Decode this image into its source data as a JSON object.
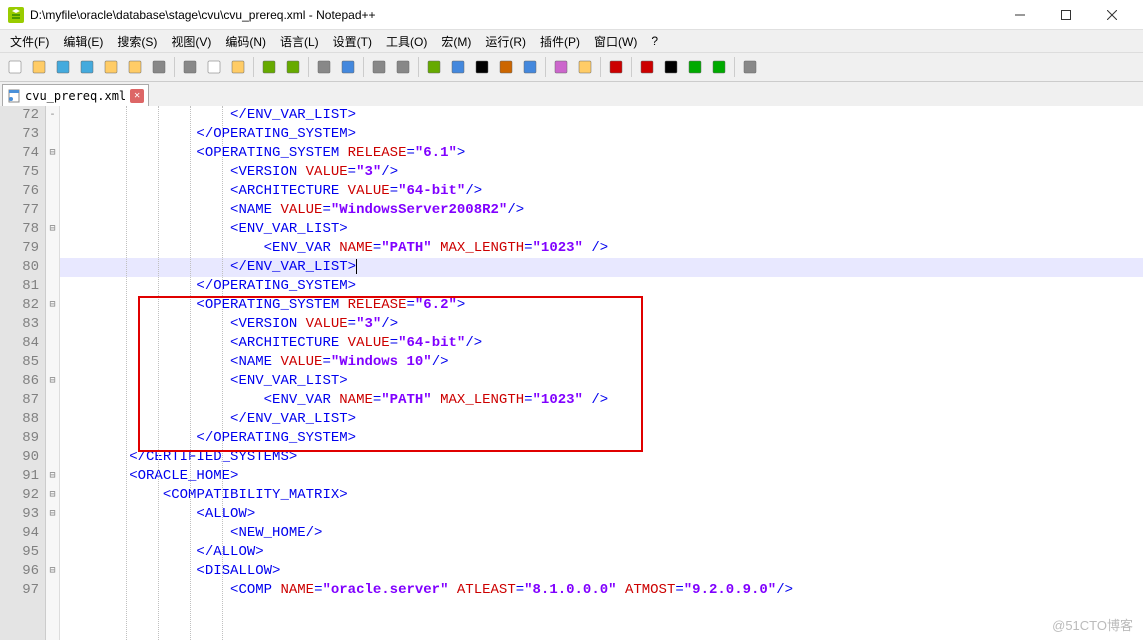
{
  "window": {
    "title": "D:\\myfile\\oracle\\database\\stage\\cvu\\cvu_prereq.xml - Notepad++"
  },
  "menu": {
    "items": [
      "文件(F)",
      "编辑(E)",
      "搜索(S)",
      "视图(V)",
      "编码(N)",
      "语言(L)",
      "设置(T)",
      "工具(O)",
      "宏(M)",
      "运行(R)",
      "插件(P)",
      "窗口(W)",
      "?"
    ]
  },
  "tab": {
    "name": "cvu_prereq.xml"
  },
  "gutter": {
    "start": 72,
    "end": 97
  },
  "code": {
    "lines": [
      {
        "n": 72,
        "ind": 20,
        "parts": [
          {
            "c": "t-blue",
            "t": "</"
          },
          {
            "c": "t-blue",
            "t": "ENV_VAR_LIST"
          },
          {
            "c": "t-blue",
            "t": ">"
          }
        ]
      },
      {
        "n": 73,
        "ind": 16,
        "parts": [
          {
            "c": "t-blue",
            "t": "</"
          },
          {
            "c": "t-blue",
            "t": "OPERATING_SYSTEM"
          },
          {
            "c": "t-blue",
            "t": ">"
          }
        ]
      },
      {
        "n": 74,
        "ind": 16,
        "parts": [
          {
            "c": "t-blue",
            "t": "<"
          },
          {
            "c": "t-blue",
            "t": "OPERATING_SYSTEM"
          },
          {
            "c": "",
            "t": " "
          },
          {
            "c": "t-red",
            "t": "RELEASE"
          },
          {
            "c": "t-blue",
            "t": "="
          },
          {
            "c": "t-purple bold",
            "t": "\"6.1\""
          },
          {
            "c": "t-blue",
            "t": ">"
          }
        ]
      },
      {
        "n": 75,
        "ind": 20,
        "parts": [
          {
            "c": "t-blue",
            "t": "<"
          },
          {
            "c": "t-blue",
            "t": "VERSION"
          },
          {
            "c": "",
            "t": " "
          },
          {
            "c": "t-red",
            "t": "VALUE"
          },
          {
            "c": "t-blue",
            "t": "="
          },
          {
            "c": "t-purple bold",
            "t": "\"3\""
          },
          {
            "c": "t-blue",
            "t": "/>"
          }
        ]
      },
      {
        "n": 76,
        "ind": 20,
        "parts": [
          {
            "c": "t-blue",
            "t": "<"
          },
          {
            "c": "t-blue",
            "t": "ARCHITECTURE"
          },
          {
            "c": "",
            "t": " "
          },
          {
            "c": "t-red",
            "t": "VALUE"
          },
          {
            "c": "t-blue",
            "t": "="
          },
          {
            "c": "t-purple bold",
            "t": "\"64-bit\""
          },
          {
            "c": "t-blue",
            "t": "/>"
          }
        ]
      },
      {
        "n": 77,
        "ind": 20,
        "parts": [
          {
            "c": "t-blue",
            "t": "<"
          },
          {
            "c": "t-blue",
            "t": "NAME"
          },
          {
            "c": "",
            "t": " "
          },
          {
            "c": "t-red",
            "t": "VALUE"
          },
          {
            "c": "t-blue",
            "t": "="
          },
          {
            "c": "t-purple bold",
            "t": "\"WindowsServer2008R2\""
          },
          {
            "c": "t-blue",
            "t": "/>"
          }
        ]
      },
      {
        "n": 78,
        "ind": 20,
        "parts": [
          {
            "c": "t-blue",
            "t": "<"
          },
          {
            "c": "t-blue",
            "t": "ENV_VAR_LIST"
          },
          {
            "c": "t-blue",
            "t": ">"
          }
        ]
      },
      {
        "n": 79,
        "ind": 24,
        "parts": [
          {
            "c": "t-blue",
            "t": "<"
          },
          {
            "c": "t-blue",
            "t": "ENV_VAR"
          },
          {
            "c": "",
            "t": " "
          },
          {
            "c": "t-red",
            "t": "NAME"
          },
          {
            "c": "t-blue",
            "t": "="
          },
          {
            "c": "t-purple bold",
            "t": "\"PATH\""
          },
          {
            "c": "",
            "t": " "
          },
          {
            "c": "t-red",
            "t": "MAX_LENGTH"
          },
          {
            "c": "t-blue",
            "t": "="
          },
          {
            "c": "t-purple bold",
            "t": "\"1023\""
          },
          {
            "c": "",
            "t": " "
          },
          {
            "c": "t-blue",
            "t": "/>"
          }
        ]
      },
      {
        "n": 80,
        "ind": 20,
        "hl": true,
        "cursor": true,
        "parts": [
          {
            "c": "t-blue",
            "t": "</"
          },
          {
            "c": "t-blue",
            "t": "ENV_VAR_LIST"
          },
          {
            "c": "t-blue",
            "t": ">"
          }
        ]
      },
      {
        "n": 81,
        "ind": 16,
        "parts": [
          {
            "c": "t-blue",
            "t": "</"
          },
          {
            "c": "t-blue",
            "t": "OPERATING_SYSTEM"
          },
          {
            "c": "t-blue",
            "t": ">"
          }
        ]
      },
      {
        "n": 82,
        "ind": 16,
        "parts": [
          {
            "c": "t-blue",
            "t": "<"
          },
          {
            "c": "t-blue",
            "t": "OPERATING_SYSTEM"
          },
          {
            "c": "",
            "t": " "
          },
          {
            "c": "t-red",
            "t": "RELEASE"
          },
          {
            "c": "t-blue",
            "t": "="
          },
          {
            "c": "t-purple bold",
            "t": "\"6.2\""
          },
          {
            "c": "t-blue",
            "t": ">"
          }
        ]
      },
      {
        "n": 83,
        "ind": 20,
        "parts": [
          {
            "c": "t-blue",
            "t": "<"
          },
          {
            "c": "t-blue",
            "t": "VERSION"
          },
          {
            "c": "",
            "t": " "
          },
          {
            "c": "t-red",
            "t": "VALUE"
          },
          {
            "c": "t-blue",
            "t": "="
          },
          {
            "c": "t-purple bold",
            "t": "\"3\""
          },
          {
            "c": "t-blue",
            "t": "/>"
          }
        ]
      },
      {
        "n": 84,
        "ind": 20,
        "parts": [
          {
            "c": "t-blue",
            "t": "<"
          },
          {
            "c": "t-blue",
            "t": "ARCHITECTURE"
          },
          {
            "c": "",
            "t": " "
          },
          {
            "c": "t-red",
            "t": "VALUE"
          },
          {
            "c": "t-blue",
            "t": "="
          },
          {
            "c": "t-purple bold",
            "t": "\"64-bit\""
          },
          {
            "c": "t-blue",
            "t": "/>"
          }
        ]
      },
      {
        "n": 85,
        "ind": 20,
        "parts": [
          {
            "c": "t-blue",
            "t": "<"
          },
          {
            "c": "t-blue",
            "t": "NAME"
          },
          {
            "c": "",
            "t": " "
          },
          {
            "c": "t-red",
            "t": "VALUE"
          },
          {
            "c": "t-blue",
            "t": "="
          },
          {
            "c": "t-purple bold",
            "t": "\"Windows 10\""
          },
          {
            "c": "t-blue",
            "t": "/>"
          }
        ]
      },
      {
        "n": 86,
        "ind": 20,
        "parts": [
          {
            "c": "t-blue",
            "t": "<"
          },
          {
            "c": "t-blue",
            "t": "ENV_VAR_LIST"
          },
          {
            "c": "t-blue",
            "t": ">"
          }
        ]
      },
      {
        "n": 87,
        "ind": 24,
        "parts": [
          {
            "c": "t-blue",
            "t": "<"
          },
          {
            "c": "t-blue",
            "t": "ENV_VAR"
          },
          {
            "c": "",
            "t": " "
          },
          {
            "c": "t-red",
            "t": "NAME"
          },
          {
            "c": "t-blue",
            "t": "="
          },
          {
            "c": "t-purple bold",
            "t": "\"PATH\""
          },
          {
            "c": "",
            "t": " "
          },
          {
            "c": "t-red",
            "t": "MAX_LENGTH"
          },
          {
            "c": "t-blue",
            "t": "="
          },
          {
            "c": "t-purple bold",
            "t": "\"1023\""
          },
          {
            "c": "",
            "t": " "
          },
          {
            "c": "t-blue",
            "t": "/>"
          }
        ]
      },
      {
        "n": 88,
        "ind": 20,
        "parts": [
          {
            "c": "t-blue",
            "t": "</"
          },
          {
            "c": "t-blue",
            "t": "ENV_VAR_LIST"
          },
          {
            "c": "t-blue",
            "t": ">"
          }
        ]
      },
      {
        "n": 89,
        "ind": 16,
        "parts": [
          {
            "c": "t-blue",
            "t": "</"
          },
          {
            "c": "t-blue",
            "t": "OPERATING_SYSTEM"
          },
          {
            "c": "t-blue",
            "t": ">"
          }
        ]
      },
      {
        "n": 90,
        "ind": 8,
        "parts": [
          {
            "c": "t-blue",
            "t": "</"
          },
          {
            "c": "t-blue",
            "t": "CERTIFIED_SYSTEMS"
          },
          {
            "c": "t-blue",
            "t": ">"
          }
        ]
      },
      {
        "n": 91,
        "ind": 8,
        "parts": [
          {
            "c": "t-blue",
            "t": "<"
          },
          {
            "c": "t-blue",
            "t": "ORACLE_HOME"
          },
          {
            "c": "t-blue",
            "t": ">"
          }
        ]
      },
      {
        "n": 92,
        "ind": 12,
        "parts": [
          {
            "c": "t-blue",
            "t": "<"
          },
          {
            "c": "t-blue",
            "t": "COMPATIBILITY_MATRIX"
          },
          {
            "c": "t-blue",
            "t": ">"
          }
        ]
      },
      {
        "n": 93,
        "ind": 16,
        "parts": [
          {
            "c": "t-blue",
            "t": "<"
          },
          {
            "c": "t-blue",
            "t": "ALLOW"
          },
          {
            "c": "t-blue",
            "t": ">"
          }
        ]
      },
      {
        "n": 94,
        "ind": 20,
        "parts": [
          {
            "c": "t-blue",
            "t": "<"
          },
          {
            "c": "t-blue",
            "t": "NEW_HOME"
          },
          {
            "c": "t-blue",
            "t": "/>"
          }
        ]
      },
      {
        "n": 95,
        "ind": 16,
        "parts": [
          {
            "c": "t-blue",
            "t": "</"
          },
          {
            "c": "t-blue",
            "t": "ALLOW"
          },
          {
            "c": "t-blue",
            "t": ">"
          }
        ]
      },
      {
        "n": 96,
        "ind": 16,
        "parts": [
          {
            "c": "t-blue",
            "t": "<"
          },
          {
            "c": "t-blue",
            "t": "DISALLOW"
          },
          {
            "c": "t-blue",
            "t": ">"
          }
        ]
      },
      {
        "n": 97,
        "ind": 20,
        "parts": [
          {
            "c": "t-blue",
            "t": "<"
          },
          {
            "c": "t-blue",
            "t": "COMP"
          },
          {
            "c": "",
            "t": " "
          },
          {
            "c": "t-red",
            "t": "NAME"
          },
          {
            "c": "t-blue",
            "t": "="
          },
          {
            "c": "t-purple bold",
            "t": "\"oracle.server\""
          },
          {
            "c": "",
            "t": " "
          },
          {
            "c": "t-red",
            "t": "ATLEAST"
          },
          {
            "c": "t-blue",
            "t": "="
          },
          {
            "c": "t-purple bold",
            "t": "\"8.1.0.0.0\""
          },
          {
            "c": "",
            "t": " "
          },
          {
            "c": "t-red",
            "t": "ATMOST"
          },
          {
            "c": "t-blue",
            "t": "="
          },
          {
            "c": "t-purple bold",
            "t": "\"9.2.0.9.0\""
          },
          {
            "c": "t-blue",
            "t": "/>"
          }
        ]
      }
    ]
  },
  "fold": [
    "-",
    "",
    "⊟",
    "",
    "",
    "",
    "⊟",
    "",
    "",
    "",
    "⊟",
    "",
    "",
    "",
    "⊟",
    "",
    "",
    "",
    "",
    "⊟",
    "⊟",
    "⊟",
    "",
    "",
    "⊟",
    ""
  ],
  "watermark": "@51CTO博客",
  "toolbar_icons": [
    "new",
    "open",
    "save",
    "saveall",
    "close",
    "closeall",
    "print",
    "",
    "cut",
    "copy",
    "paste",
    "",
    "undo",
    "redo",
    "",
    "find",
    "replace",
    "",
    "zoomin",
    "zoomout",
    "",
    "sync",
    "wrap",
    "allchars",
    "indent",
    "fold",
    "",
    "userlang",
    "doc",
    "",
    "monitor",
    "",
    "rec",
    "stop",
    "play",
    "playall",
    "",
    "panel"
  ]
}
